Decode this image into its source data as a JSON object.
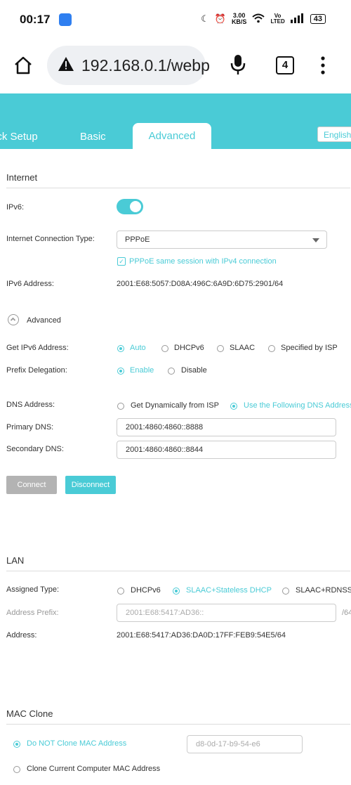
{
  "status_bar": {
    "time": "00:17",
    "speed_top": "3.00",
    "speed_unit": "KB/S",
    "net_top": "Vo",
    "net_bottom": "LTED",
    "battery": "43"
  },
  "browser": {
    "url": "192.168.0.1/webp",
    "tab_count": "4"
  },
  "nav": {
    "quick_setup": "ick Setup",
    "basic": "Basic",
    "advanced": "Advanced",
    "language": "English"
  },
  "internet": {
    "title": "Internet",
    "ipv6_label": "IPv6:",
    "ipv6_enabled": true,
    "conn_type_label": "Internet Connection Type:",
    "conn_type_value": "PPPoE",
    "same_session_label": "PPPoE same session with IPv4 connection",
    "ipv6_address_label": "IPv6 Address:",
    "ipv6_address_value": "2001:E68:5057:D08A:496C:6A9D:6D75:2901/64",
    "advanced_toggle": "Advanced",
    "get_ipv6_label": "Get IPv6 Address:",
    "get_ipv6_options": [
      "Auto",
      "DHCPv6",
      "SLAAC",
      "Specified by ISP"
    ],
    "prefix_delegation_label": "Prefix Delegation:",
    "prefix_options": [
      "Enable",
      "Disable"
    ],
    "dns_label": "DNS Address:",
    "dns_options": [
      "Get Dynamically from ISP",
      "Use the Following DNS Addresses"
    ],
    "primary_dns_label": "Primary DNS:",
    "primary_dns_value": "2001:4860:4860::8888",
    "secondary_dns_label": "Secondary DNS:",
    "secondary_dns_value": "2001:4860:4860::8844",
    "connect_label": "Connect",
    "disconnect_label": "Disconnect"
  },
  "lan": {
    "title": "LAN",
    "assigned_type_label": "Assigned Type:",
    "assigned_options": [
      "DHCPv6",
      "SLAAC+Stateless DHCP",
      "SLAAC+RDNSS"
    ],
    "address_prefix_label": "Address Prefix:",
    "address_prefix_value": "2001:E68:5417:AD36::",
    "prefix_suffix": "/64",
    "address_label": "Address:",
    "address_value": "2001:E68:5417:AD36:DA0D:17FF:FEB9:54E5/64"
  },
  "mac_clone": {
    "title": "MAC Clone",
    "options": [
      "Do NOT Clone MAC Address",
      "Clone Current Computer MAC Address"
    ],
    "mac_value": "d8-0d-17-b9-54-e6"
  },
  "colors": {
    "accent": "#4acbd6",
    "button_gray": "#b3b3b3"
  }
}
